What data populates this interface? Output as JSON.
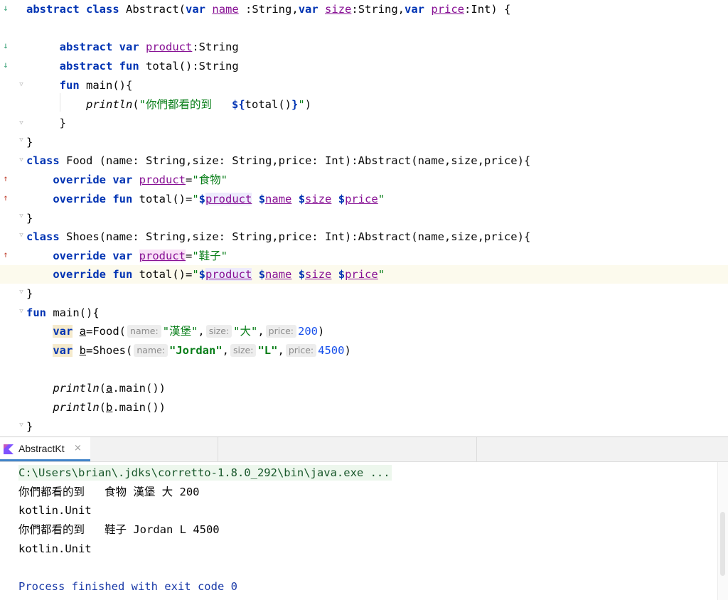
{
  "editor": {
    "line1": {
      "kw1": "abstract",
      "kw2": "class",
      "name": "Abstract(",
      "kv1": "var",
      "p1": "name",
      "t1": " :String,",
      "kv2": "var",
      "p2": "size",
      "t2": ":String,",
      "kv3": "var",
      "p3": "price",
      "t3": ":Int) {"
    },
    "line3": {
      "kw1": "abstract",
      "kw2": "var",
      "prop": "product",
      "rest": ":String"
    },
    "line4": {
      "kw1": "abstract",
      "kw2": "fun",
      "rest": "total():String"
    },
    "line5": {
      "kw": "fun",
      "rest": "main(){"
    },
    "line6": {
      "fn": "println",
      "open": "(",
      "str": "\"你們都看的到   ",
      "tpl": "${",
      "call": "total()",
      "tplend": "}",
      "strend": "\"",
      "close": ")"
    },
    "line7": {
      "text": "}"
    },
    "line8": {
      "text": "}"
    },
    "line9": {
      "kw": "class",
      "rest": "Food (name: String,size: String,price: Int):Abstract(name,size,price){"
    },
    "line10": {
      "kw1": "override",
      "kw2": "var",
      "prop": "product",
      "eq": "=",
      "str": "\"食物\""
    },
    "line11": {
      "kw1": "override",
      "kw2": "fun",
      "rest": "total()=",
      "q1": "\"",
      "d1": "$",
      "v1": "product",
      "d2": "$",
      "v2": "name",
      "d3": "$",
      "v3": "size",
      "d4": "$",
      "v4": "price",
      "q2": "\""
    },
    "line12": {
      "text": "}"
    },
    "line13": {
      "kw": "class",
      "rest": "Shoes(name: String,size: String,price: Int):Abstract(name,size,price){"
    },
    "line14": {
      "kw1": "override",
      "kw2": "var",
      "prop": "product",
      "eq": "=",
      "str": "\"鞋子\""
    },
    "line15": {
      "kw1": "override",
      "kw2": "fun",
      "rest": "total()=",
      "q1": "\"",
      "d1": "$",
      "v1": "product",
      "d2": "$",
      "v2": "name",
      "d3": "$",
      "v3": "size",
      "d4": "$",
      "v4": "price",
      "q2": "\""
    },
    "line16": {
      "text": "}"
    },
    "line17": {
      "kw": "fun",
      "rest": "main(){"
    },
    "line18": {
      "kw": "var",
      "v": "a",
      "call": "=Food(",
      "h1": "name:",
      "a1": "\"漢堡\"",
      "c1": ",",
      "h2": "size:",
      "a2": "\"大\"",
      "c2": ",",
      "h3": "price:",
      "a3": "200",
      "close": ")"
    },
    "line19": {
      "kw": "var",
      "v": "b",
      "call": "=Shoes(",
      "h1": "name:",
      "a1": "\"Jordan\"",
      "c1": ",",
      "h2": "size:",
      "a2": "\"L\"",
      "c2": ",",
      "h3": "price:",
      "a3": "4500",
      "close": ")"
    },
    "line21": {
      "fn": "println",
      "open": "(",
      "v": "a",
      "rest": ".main())"
    },
    "line22": {
      "fn": "println",
      "open": "(",
      "v": "b",
      "rest": ".main())"
    },
    "line23": {
      "text": "}"
    }
  },
  "run_panel": {
    "tab_label": "AbstractKt",
    "close_glyph": "×",
    "console": [
      "C:\\Users\\brian\\.jdks\\corretto-1.8.0_292\\bin\\java.exe ...",
      "你們都看的到   食物 漢堡 大 200",
      "kotlin.Unit",
      "你們都看的到   鞋子 Jordan L 4500",
      "kotlin.Unit",
      "Process finished with exit code 0"
    ]
  },
  "icons": {
    "gutter_down": "↓",
    "gutter_up": "↑",
    "fold": "▽"
  },
  "colors": {
    "keyword": "#0033b3",
    "property": "#871094",
    "string": "#067d17",
    "number": "#1750eb",
    "current_line": "#fcfaed",
    "tab_underline": "#4083c9"
  }
}
